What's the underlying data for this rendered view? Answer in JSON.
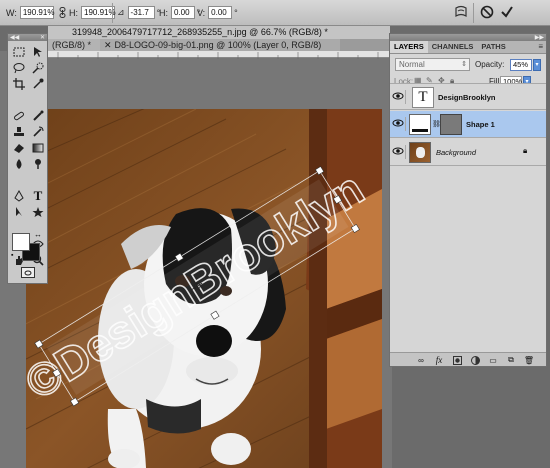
{
  "options_bar": {
    "width_label": "W:",
    "width_value": "190.91%",
    "height_label": "H:",
    "height_value": "190.91%",
    "angle_value": "-31.7",
    "h_skew_label": "H:",
    "h_skew_value": "0.00",
    "v_skew_label": "V:",
    "v_skew_value": "0.00",
    "icons": [
      "link-icon",
      "angle-icon",
      "warp-icon",
      "cancel-icon",
      "commit-icon"
    ]
  },
  "tabs": [
    {
      "label": "319948_2006479717712_268935255_n.jpg @ 66.7% (RGB/8) *"
    },
    {
      "label": "(RGB/8) *"
    },
    {
      "label": "D8-LOGO-09-big-01.png @ 100% (Layer 0, RGB/8)"
    }
  ],
  "watermark_text": "©DesignBrooklyn",
  "layers_panel": {
    "tabs": [
      "LAYERS",
      "CHANNELS",
      "PATHS"
    ],
    "blend_mode": "Normal",
    "opacity_label": "Opacity:",
    "opacity_value": "45%",
    "lock_label": "Lock:",
    "fill_label": "Fill:",
    "fill_value": "100%",
    "layers": [
      {
        "name": "DesignBrooklyn",
        "type": "text",
        "thumb": "T"
      },
      {
        "name": "Shape 1",
        "type": "shape",
        "selected": true
      },
      {
        "name": "Background",
        "type": "image",
        "locked": true
      }
    ]
  },
  "colors": {
    "selection": "#aac8ee",
    "accent": "#5b8fd8",
    "floor": "#8a5428"
  }
}
